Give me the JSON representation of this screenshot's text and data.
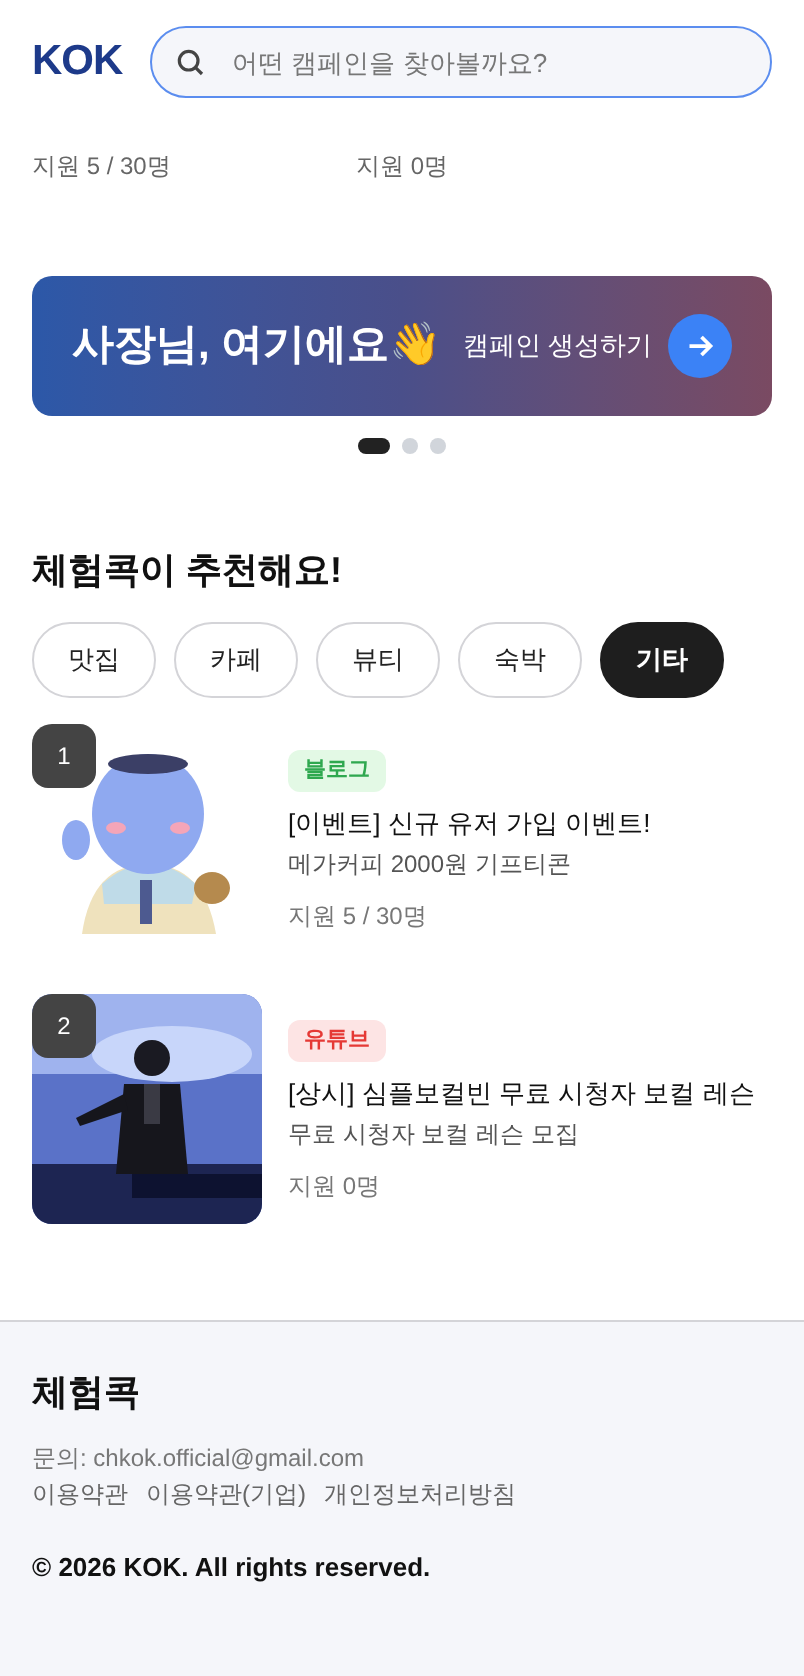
{
  "header": {
    "logo": "KOK",
    "search": {
      "placeholder": "어떤 캠페인을 찾아볼까요?"
    }
  },
  "previous_cards": [
    {
      "applicants": "지원 5 / 30명"
    },
    {
      "applicants": "지원 0명"
    }
  ],
  "banner": {
    "title": "사장님, 여기에요👋",
    "action": "캠페인 생성하기"
  },
  "carousel_dots": [
    {
      "selected": true
    },
    {
      "selected": false
    },
    {
      "selected": false
    }
  ],
  "recommend": {
    "title": "체험콕이 추천해요!",
    "chips": [
      {
        "label": "맛집",
        "selected": false
      },
      {
        "label": "카페",
        "selected": false
      },
      {
        "label": "뷰티",
        "selected": false
      },
      {
        "label": "숙박",
        "selected": false
      },
      {
        "label": "기타",
        "selected": true
      }
    ],
    "items": [
      {
        "rank": "1",
        "image": {
          "kind": "mascot"
        },
        "tag": {
          "label": "블로그",
          "kind": "blog"
        },
        "title": "[이벤트] 신규 유저 가입 이벤트!",
        "subtitle": "메가커피 2000원 기프티콘",
        "applicants": "지원 5 / 30명"
      },
      {
        "rank": "2",
        "image": {
          "kind": "stage"
        },
        "tag": {
          "label": "유튜브",
          "kind": "youtube"
        },
        "title": "[상시] 심플보컬빈 무료 시청자 보컬 레슨",
        "subtitle": "무료 시청자 보컬 레슨 모집",
        "applicants": "지원 0명"
      }
    ]
  },
  "footer": {
    "brand": "체험콕",
    "contact": "문의: chkok.official@gmail.com",
    "links": [
      "이용약관",
      "이용약관(기업)",
      "개인정보처리방침"
    ],
    "copyright": "© 2026 KOK. All rights reserved."
  }
}
